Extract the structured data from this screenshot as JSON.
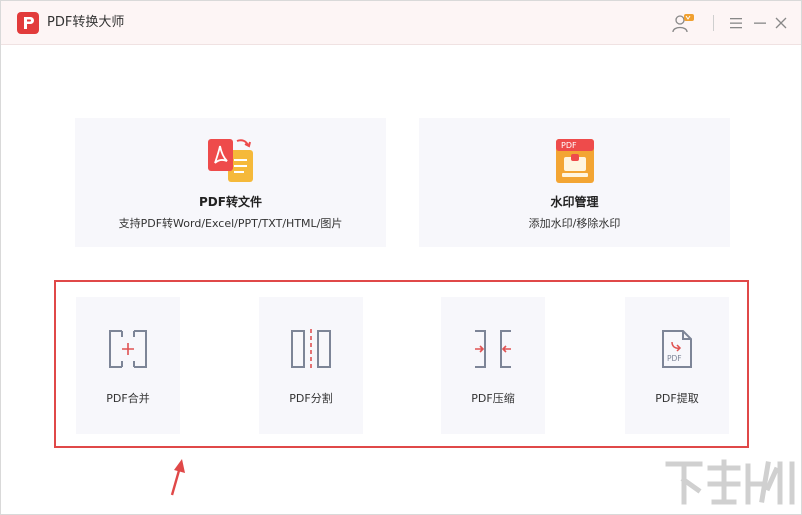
{
  "app": {
    "title": "PDF转换大师"
  },
  "features": [
    {
      "title": "PDF转文件",
      "desc": "支持PDF转Word/Excel/PPT/TXT/HTML/图片"
    },
    {
      "title": "水印管理",
      "desc": "添加水印/移除水印"
    }
  ],
  "tools": [
    {
      "label": "PDF合并"
    },
    {
      "label": "PDF分割"
    },
    {
      "label": "PDF压缩"
    },
    {
      "label": "PDF提取"
    }
  ],
  "icons": {
    "logo": "pdf-logo-icon",
    "user": "user-vip-icon",
    "menu": "menu-icon",
    "minimize": "minimize-icon",
    "close": "close-icon",
    "watermark_tag": "PDF",
    "extract_tag": "PDF"
  },
  "colors": {
    "accent": "#e23b3b",
    "highlight": "#e04848",
    "card_bg": "#f7f7fb",
    "icon_gray": "#7d8597",
    "icon_red": "#e05252"
  }
}
